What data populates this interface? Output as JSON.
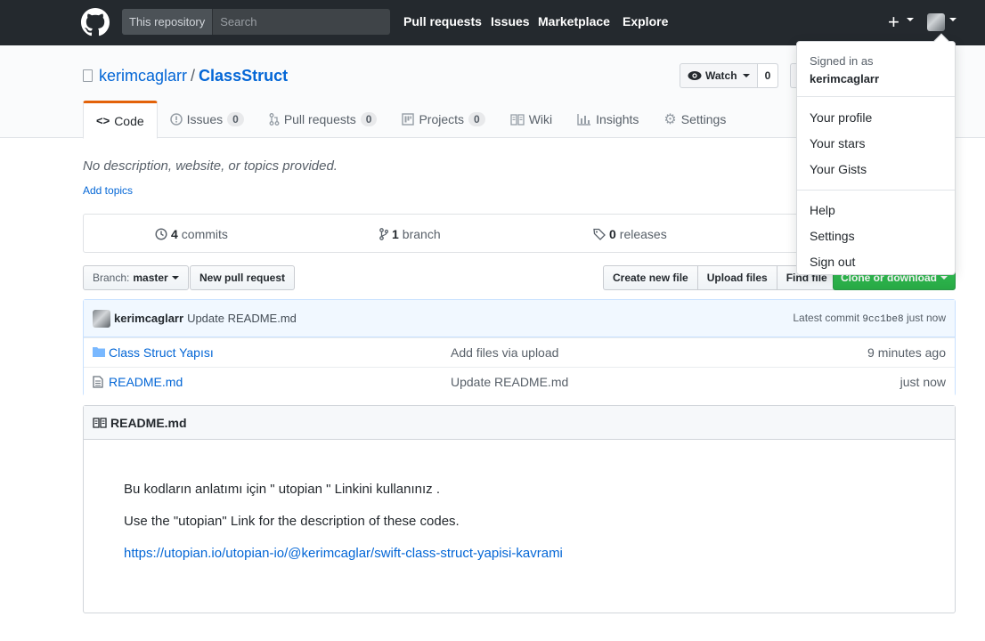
{
  "header": {
    "search_scope": "This repository",
    "search_placeholder": "Search",
    "nav": [
      "Pull requests",
      "Issues",
      "Marketplace",
      "Explore"
    ],
    "plus": "+"
  },
  "repo": {
    "owner": "kerimcaglarr",
    "name": "ClassStruct",
    "separator": "/",
    "watch_label": "Watch",
    "watch_count": "0",
    "tabs": [
      {
        "label": "Code",
        "icon": "<>",
        "counter": null
      },
      {
        "label": "Issues",
        "icon": "!",
        "counter": "0"
      },
      {
        "label": "Pull requests",
        "icon": "pr",
        "counter": "0"
      },
      {
        "label": "Projects",
        "icon": "project",
        "counter": "0"
      },
      {
        "label": "Wiki",
        "icon": "book",
        "counter": null
      },
      {
        "label": "Insights",
        "icon": "graph",
        "counter": null
      },
      {
        "label": "Settings",
        "icon": "gear",
        "counter": null
      }
    ],
    "description": "No description, website, or topics provided.",
    "add_topics": "Add topics"
  },
  "numbers": {
    "commits_count": "4",
    "commits_label": "commits",
    "branch_count": "1",
    "branch_label": "branch",
    "releases_count": "0",
    "releases_label": "releases"
  },
  "toolbar": {
    "branch_prefix": "Branch:",
    "branch_name": "master",
    "new_pr": "New pull request",
    "create_file": "Create new file",
    "upload_files": "Upload files",
    "find_file": "Find file",
    "clone": "Clone or download"
  },
  "commit": {
    "author": "kerimcaglarr",
    "message": "Update README.md",
    "latest_label": "Latest commit",
    "sha": "9cc1be8",
    "time": "just now"
  },
  "files": [
    {
      "name": "Class Struct Yapısı",
      "type": "folder",
      "message": "Add files via upload",
      "age": "9 minutes ago"
    },
    {
      "name": "README.md",
      "type": "file",
      "message": "Update README.md",
      "age": "just now"
    }
  ],
  "readme": {
    "title": "README.md",
    "line1": "Bu kodların anlatımı için \" utopian \" Linkini kullanınız .",
    "line2": "Use the \"utopian\" Link for the description of these codes.",
    "link": "https://utopian.io/utopian-io/@kerimcaglar/swift-class-struct-yapisi-kavrami"
  },
  "user_menu": {
    "signed_in_as": "Signed in as",
    "username": "kerimcaglarr",
    "items_a": [
      "Your profile",
      "Your stars",
      "Your Gists"
    ],
    "items_b": [
      "Help",
      "Settings",
      "Sign out"
    ]
  }
}
